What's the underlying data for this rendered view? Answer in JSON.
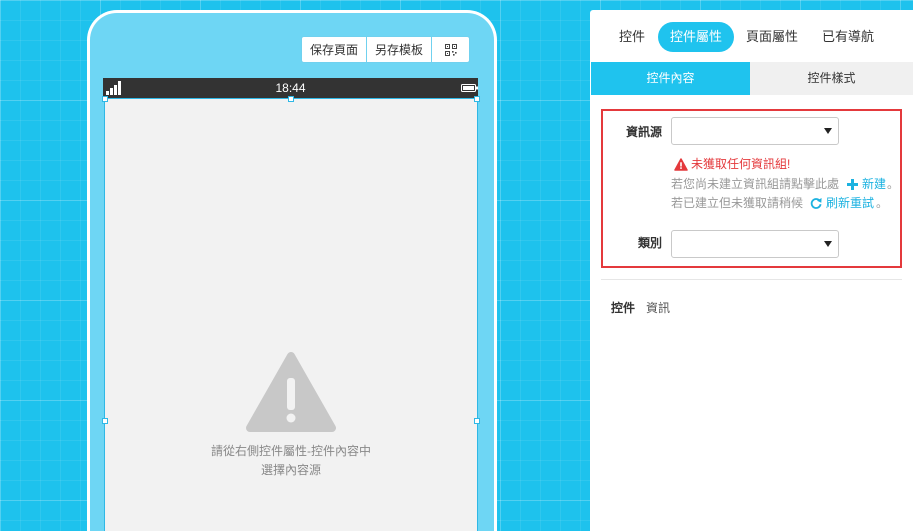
{
  "colors": {
    "canvas_bg": "#1ec2ed",
    "accent": "#1fc3ee",
    "danger": "#e4393c",
    "link": "#1cb2e0",
    "status_bar": "#333333",
    "content_bg": "#f2f2f2"
  },
  "phone": {
    "toolbar": {
      "save_page": "保存頁面",
      "save_template": "另存模板",
      "qr_icon": "qr-code-icon"
    },
    "status_bar": {
      "signal_icon": "signal-icon",
      "time": "18:44",
      "battery_icon": "battery-icon"
    },
    "placeholder": {
      "icon": "warning-triangle-icon",
      "line1": "請從右側控件屬性-控件內容中",
      "line2": "選擇內容源"
    }
  },
  "panel": {
    "tabs": [
      {
        "label": "控件",
        "active": false
      },
      {
        "label": "控件屬性",
        "active": true
      },
      {
        "label": "頁面屬性",
        "active": false
      },
      {
        "label": "已有導航",
        "active": false
      }
    ],
    "subtabs": [
      {
        "label": "控件內容",
        "active": true
      },
      {
        "label": "控件樣式",
        "active": false
      }
    ],
    "form": {
      "source": {
        "label": "資訊源",
        "value": ""
      },
      "warning": {
        "icon": "warning-icon",
        "text": "未獲取任何資訊組!"
      },
      "hint_create": {
        "text": "若您尚未建立資訊組請點擊此處",
        "link_icon": "plus-icon",
        "link": "新建",
        "end": "。"
      },
      "hint_refresh": {
        "text": "若已建立但未獲取請稍候",
        "link_icon": "refresh-icon",
        "link": "刷新重試",
        "end": "。"
      },
      "category": {
        "label": "類別",
        "value": ""
      }
    },
    "widget_info": {
      "label": "控件",
      "value": "資訊"
    }
  }
}
